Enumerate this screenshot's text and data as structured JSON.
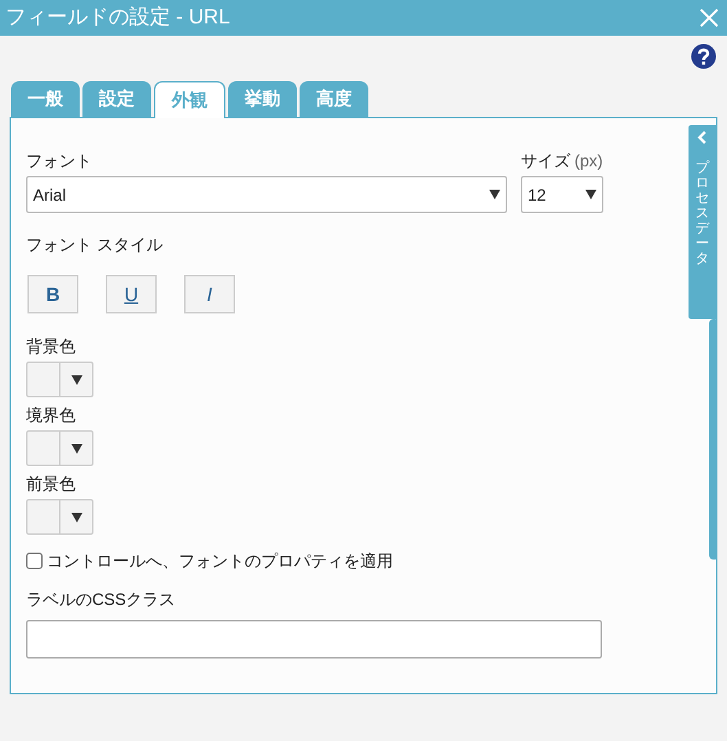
{
  "window": {
    "title": "フィールドの設定 - URL"
  },
  "tabs": [
    {
      "label": "一般",
      "selected": false
    },
    {
      "label": "設定",
      "selected": false
    },
    {
      "label": "外観",
      "selected": true
    },
    {
      "label": "挙動",
      "selected": false
    },
    {
      "label": "高度",
      "selected": false
    }
  ],
  "font": {
    "label": "フォント",
    "value": "Arial"
  },
  "size": {
    "label": "サイズ",
    "unit": "(px)",
    "value": "12"
  },
  "font_style": {
    "label": "フォント スタイル",
    "buttons": [
      {
        "label": "B",
        "kind": "bold"
      },
      {
        "label": "U",
        "kind": "underline"
      },
      {
        "label": "I",
        "kind": "italic"
      }
    ]
  },
  "colors": [
    {
      "label": "背景色"
    },
    {
      "label": "境界色"
    },
    {
      "label": "前景色"
    }
  ],
  "apply_checkbox": {
    "label": "コントロールへ、フォントのプロパティを適用",
    "checked": false
  },
  "label_css": {
    "label": "ラベルのCSSクラス"
  },
  "side_panel": {
    "label": "プロセスデータ"
  }
}
